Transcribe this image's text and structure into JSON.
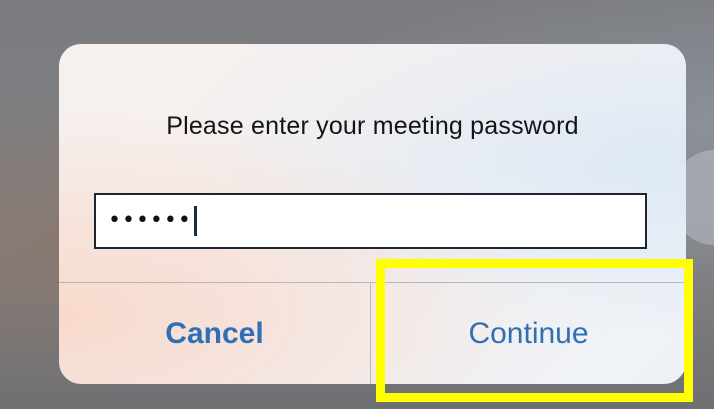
{
  "dialog": {
    "message": "Please enter your meeting password",
    "password": {
      "masked_value": "••••••",
      "value_length": 6
    },
    "buttons": {
      "cancel_label": "Cancel",
      "continue_label": "Continue"
    }
  },
  "colors": {
    "button_text": "#2f6fb5",
    "highlight": "#ffff00",
    "input_border": "#1c2430"
  }
}
